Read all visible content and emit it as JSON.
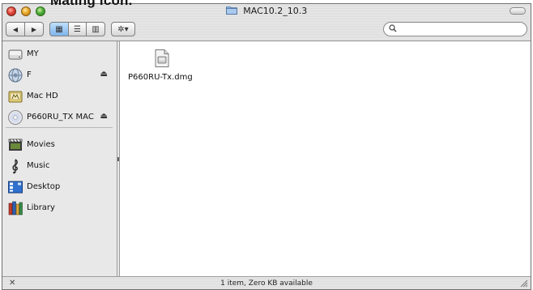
{
  "caption": "Mating icon.",
  "window": {
    "title": "MAC10.2_10.3"
  },
  "toolbar": {
    "back_icon": "back-arrow-icon",
    "forward_icon": "forward-arrow-icon",
    "view_icon_glyph": "▦",
    "view_list_glyph": "☰",
    "view_column_glyph": "▥",
    "action_glyph": "✲▾",
    "back_glyph": "◀",
    "forward_glyph": "▶"
  },
  "search": {
    "placeholder": "",
    "value": ""
  },
  "sidebar": {
    "items": [
      {
        "label": "MY",
        "icon": "hard-drive-icon",
        "eject": false
      },
      {
        "label": "F",
        "icon": "network-drive-icon",
        "eject": true
      },
      {
        "label": "Mac HD",
        "icon": "mac-hd-icon",
        "eject": false
      },
      {
        "label": "P660RU_TX MAC",
        "icon": "cd-icon",
        "eject": true
      },
      {
        "label": "Movies",
        "icon": "movies-icon",
        "eject": false
      },
      {
        "label": "Music",
        "icon": "music-icon",
        "eject": false
      },
      {
        "label": "Desktop",
        "icon": "desktop-icon",
        "eject": false
      },
      {
        "label": "Library",
        "icon": "library-icon",
        "eject": false
      }
    ],
    "eject_glyph": "⏏"
  },
  "content": {
    "files": [
      {
        "name": "P660RU-Tx.dmg",
        "icon": "dmg-file-icon"
      }
    ]
  },
  "status": {
    "text": "1 item, Zero KB available"
  },
  "colors": {
    "window_bg": "#e8e8e8",
    "content_bg": "#ffffff",
    "selected_view": "#7fb4ea"
  }
}
